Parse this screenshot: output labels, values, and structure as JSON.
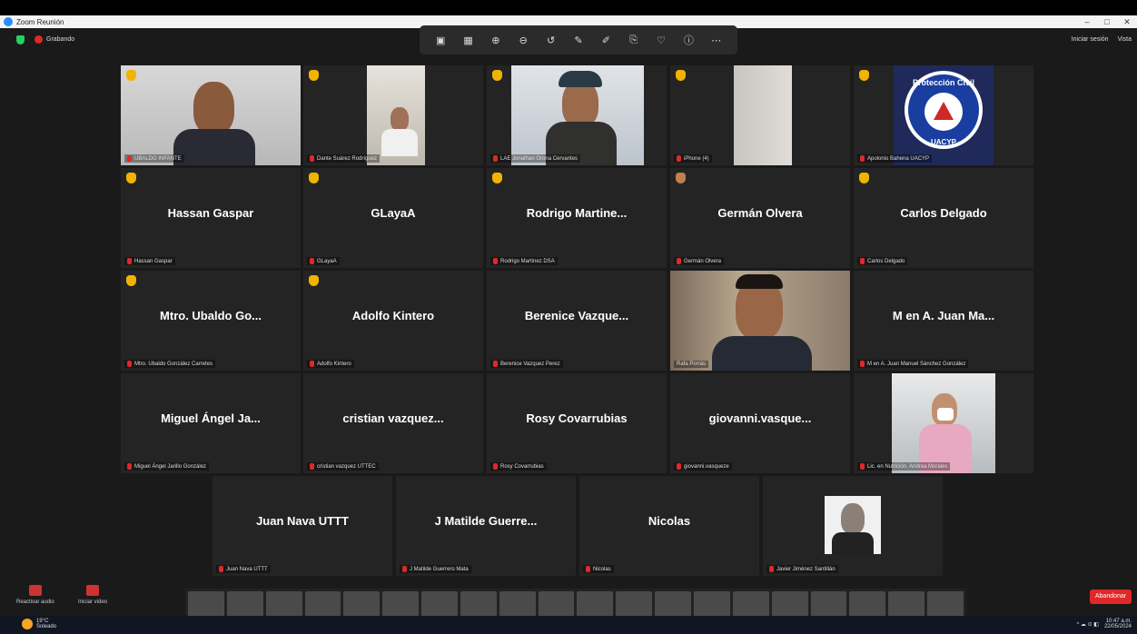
{
  "window": {
    "title": "Zoom Reunión",
    "controls": [
      "–",
      "□",
      "✕"
    ]
  },
  "meeting": {
    "recording_label": "Grabando",
    "signin_label": "Iniciar sesión",
    "view_label": "Vista"
  },
  "annotation_toolbar": {
    "icons": [
      "▣",
      "▦",
      "⊕",
      "⊖",
      "↺",
      "✎",
      "✐",
      "⎘",
      "♡",
      "ⓘ",
      "⋯"
    ]
  },
  "tiles": [
    {
      "label": "UBALDO INFANTE",
      "center": "",
      "video": "man1"
    },
    {
      "label": "Dante Suárez Rodríguez",
      "center": "",
      "video": "room"
    },
    {
      "label": "LAE Jonathan Orona Cervantes",
      "center": "",
      "video": "cap"
    },
    {
      "label": "iPhone (4)",
      "center": "",
      "video": "wall"
    },
    {
      "label": "Apolonio Bahena UACYP",
      "center": "",
      "video": "logo"
    },
    {
      "label": "Hassan Gaspar",
      "center": "Hassan Gaspar"
    },
    {
      "label": "GLayaA",
      "center": "GLayaA"
    },
    {
      "label": "Rodrigo Martinez DSA",
      "center": "Rodrigo Martine..."
    },
    {
      "label": "Germán Olvera",
      "center": "Germán Olvera"
    },
    {
      "label": "Carlos Delgado",
      "center": "Carlos Delgado"
    },
    {
      "label": "Mtro. Ubaldo González Carretes",
      "center": "Mtro. Ubaldo Go..."
    },
    {
      "label": "Adolfo Kintero",
      "center": "Adolfo Kintero"
    },
    {
      "label": "Berenice Vazquez Perez",
      "center": "Berenice Vazque..."
    },
    {
      "label": "Rafa Porrás",
      "center": "",
      "video": "man2"
    },
    {
      "label": "M en A. Juan Manuel Sánchez González",
      "center": "M en A. Juan Ma..."
    },
    {
      "label": "Miguel Ángel Jarillo González",
      "center": "Miguel Ángel Ja..."
    },
    {
      "label": "cristian vazquez UTTEC",
      "center": "cristian vazquez..."
    },
    {
      "label": "Rosy Covarrubias",
      "center": "Rosy Covarrubias"
    },
    {
      "label": "giovanni.vasqueze",
      "center": "giovanni.vasque..."
    },
    {
      "label": "Lic. en Nutrición. Andrea Morales",
      "center": "",
      "video": "woman"
    },
    {
      "label": "Juan Nava UTTT",
      "center": "Juan Nava UTTT"
    },
    {
      "label": "J Matilde Guerrero Mata",
      "center": "J Matilde Guerre..."
    },
    {
      "label": "Nicolas",
      "center": "Nicolas"
    },
    {
      "label": "Javier Jiménez Santillán",
      "center": "",
      "video": "photo"
    }
  ],
  "logo_text": {
    "top": "Protección Civil",
    "bottom": "UACYP"
  },
  "controls": {
    "audio_label": "Reactivar audio",
    "video_label": "Iniciar video",
    "end_label": "Abandonar"
  },
  "taskbar": {
    "temp": "19°C",
    "weather": "Soleado",
    "time": "10:47 a.m.",
    "date": "22/05/2024"
  }
}
